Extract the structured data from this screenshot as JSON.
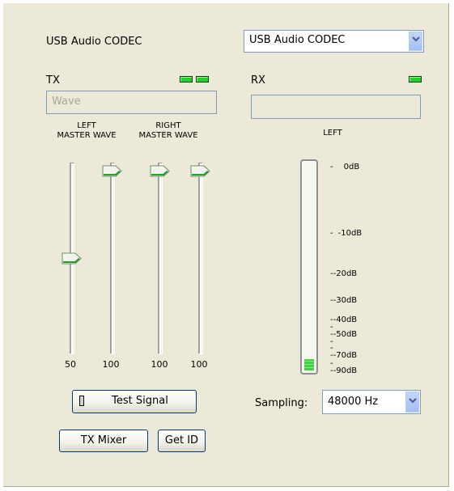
{
  "device_label": "USB Audio CODEC",
  "device_select": {
    "value": "USB Audio CODEC"
  },
  "tx": {
    "label": "TX",
    "source_field": "Wave",
    "indicator_color": "#22d327",
    "left_header": "LEFT\nMASTER WAVE",
    "right_header": "RIGHT\nMASTER WAVE",
    "sliders": [
      {
        "name": "left-master",
        "value": "50",
        "level": 50
      },
      {
        "name": "left-wave",
        "value": "100",
        "level": 100
      },
      {
        "name": "right-master",
        "value": "100",
        "level": 100
      },
      {
        "name": "right-wave",
        "value": "100",
        "level": 100
      }
    ]
  },
  "rx": {
    "label": "RX",
    "source_field": "",
    "meter_header": "LEFT",
    "meter_level_fraction": 0.04,
    "scale": [
      "0dB",
      "-10dB",
      "-20dB",
      "-30dB",
      "-40dB",
      "-50dB",
      "-70dB",
      "-90dB"
    ]
  },
  "sampling": {
    "label": "Sampling:",
    "value": "48000 Hz"
  },
  "buttons": {
    "test_signal": "Test Signal",
    "tx_mixer": "TX Mixer",
    "get_id": "Get ID"
  }
}
